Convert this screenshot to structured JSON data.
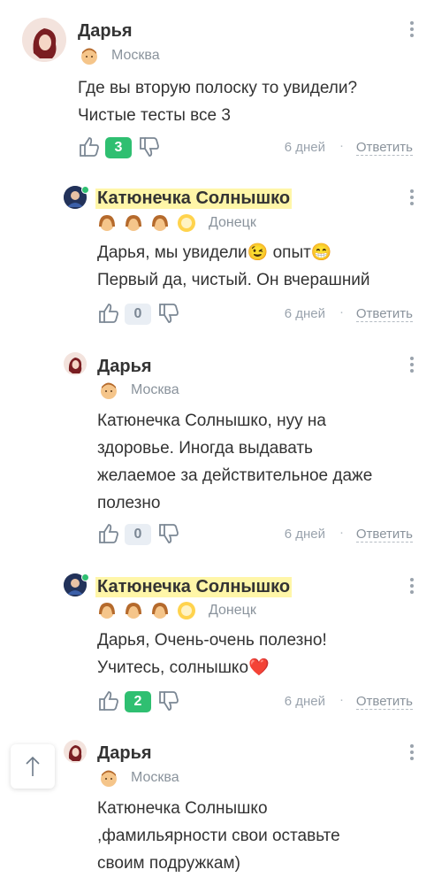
{
  "comments": [
    {
      "author": "Дарья",
      "city": "Москва",
      "text_lines": [
        "Где вы вторую полоску то увидели?",
        "Чистые тесты все 3"
      ],
      "likes": "3",
      "time": "6 дней",
      "reply_label": "Ответить"
    },
    {
      "author": "Катюнечка Солнышко",
      "city": "Донецк",
      "text_lines": [
        "Дарья, мы увидели😉 опыт😁",
        "Первый да, чистый. Он вчерашний"
      ],
      "likes": "0",
      "time": "6 дней",
      "reply_label": "Ответить"
    },
    {
      "author": "Дарья",
      "city": "Москва",
      "text_lines": [
        "Катюнечка Солнышко, нуу на",
        "здоровье. Иногда выдавать",
        "желаемое за действительное даже",
        "полезно"
      ],
      "likes": "0",
      "time": "6 дней",
      "reply_label": "Ответить"
    },
    {
      "author": "Катюнечка Солнышко",
      "city": "Донецк",
      "text_lines": [
        "Дарья, Очень-очень полезно!",
        "Учитесь, солнышко❤️"
      ],
      "likes": "2",
      "time": "6 дней",
      "reply_label": "Ответить"
    },
    {
      "author": "Дарья",
      "city": "Москва",
      "text_lines": [
        "Катюнечка Солнышко",
        ",фамильярности свои оставьте",
        "своим подружкам)"
      ]
    }
  ],
  "colors": {
    "accent_green": "#2fbf71",
    "highlight": "#fff6a8",
    "muted": "#8a939c"
  }
}
